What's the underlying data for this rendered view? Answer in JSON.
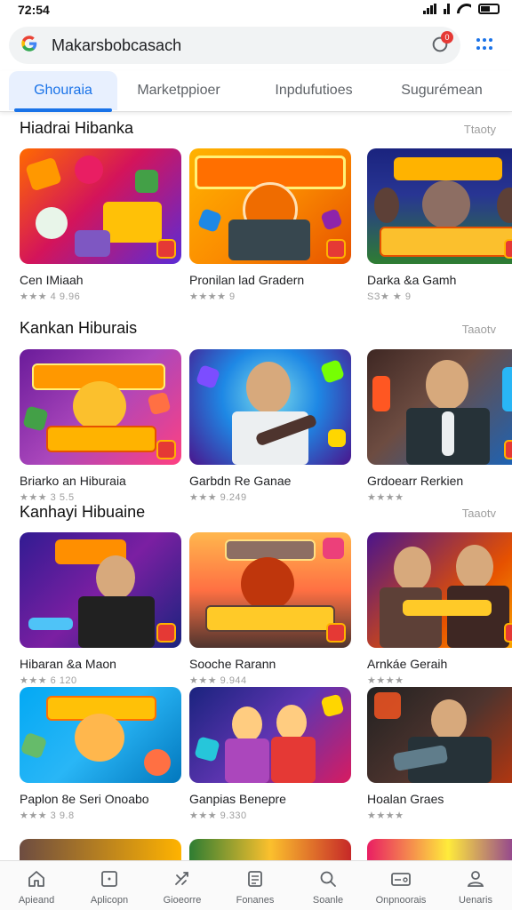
{
  "status": {
    "time": "72:54"
  },
  "search": {
    "query": "Makarsbobcasach",
    "badge": "0"
  },
  "tabs": [
    {
      "label": "Ghouraia",
      "active": true
    },
    {
      "label": "Marketppioer",
      "active": false
    },
    {
      "label": "Inpdufutioes",
      "active": false
    },
    {
      "label": "Sugurémean",
      "active": false
    }
  ],
  "sections": [
    {
      "title": "Hiadrai Hibanka",
      "more": "Ttaoty",
      "items": [
        {
          "name": "Cen IMiaah",
          "meta": "★★★ 4 9.96"
        },
        {
          "name": "Pronilan lad Gradern",
          "meta": "★★★★ 9"
        },
        {
          "name": "Darka &a Gamh",
          "meta": "SЗ★ ★ 9"
        }
      ]
    },
    {
      "title": "Kankan Hiburais",
      "more": "Taaotv",
      "items": [
        {
          "name": "Briarko an Hiburaia",
          "meta": "★★★ 3 5.5"
        },
        {
          "name": "Garbdn Re Ganae",
          "meta": "★★★ 9.249"
        },
        {
          "name": "Grdoearr Rerkien",
          "meta": "★★★★"
        }
      ]
    },
    {
      "title": "Kanhayi Hibuaine",
      "more": "Taaotv",
      "items": [
        {
          "name": "Hibaran &a Maon",
          "meta": "★★★ 6 120"
        },
        {
          "name": "Sooche Rarann",
          "meta": "★★★ 9.944"
        },
        {
          "name": "Arnkáe Geraih",
          "meta": "★★★★"
        }
      ]
    },
    {
      "title": "",
      "more": "",
      "items": [
        {
          "name": "Paplon 8e Seri Onoabo",
          "meta": "★★★ 3 9.8"
        },
        {
          "name": "Ganpias Benepre",
          "meta": "★★★ 9.330"
        },
        {
          "name": "Hoalan Graes",
          "meta": "★★★★"
        }
      ]
    }
  ],
  "bottom_nav": [
    {
      "label": "Apieand",
      "icon": "home-icon"
    },
    {
      "label": "Aplicopn",
      "icon": "apps-icon"
    },
    {
      "label": "Gioeorre",
      "icon": "games-icon"
    },
    {
      "label": "Fonanes",
      "icon": "documents-icon"
    },
    {
      "label": "Soanle",
      "icon": "search-icon"
    },
    {
      "label": "Onpnoorais",
      "icon": "payment-card-icon"
    },
    {
      "label": "Uenaris",
      "icon": "account-icon"
    }
  ],
  "colors": {
    "accent": "#1a73e8",
    "badge": "#e53935"
  }
}
